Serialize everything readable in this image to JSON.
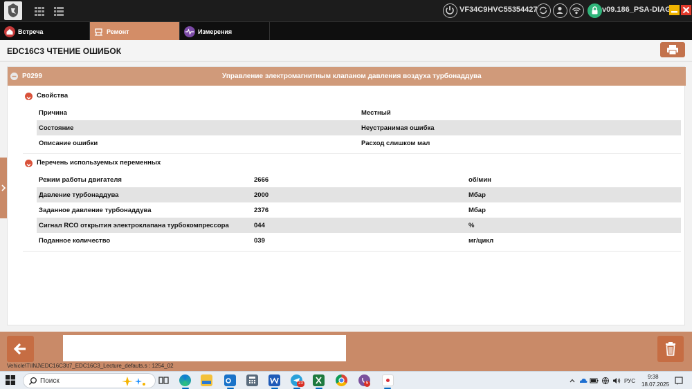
{
  "header": {
    "vin": "VF34C9HVC55354427",
    "version": "v09.186_PSA-DIAG"
  },
  "nav": {
    "tabs": [
      {
        "label": "Встреча"
      },
      {
        "label": "Ремонт"
      },
      {
        "label": "Измерения"
      }
    ]
  },
  "page": {
    "title": "EDC16C3 ЧТЕНИЕ ОШИБОК"
  },
  "fault": {
    "code": "P0299",
    "description": "Управление электромагнитным клапаном давления воздуха турбонаддува"
  },
  "properties": {
    "title": "Свойства",
    "rows": [
      {
        "name": "Причина",
        "value": "Местный"
      },
      {
        "name": "Состояние",
        "value": "Неустранимая ошибка"
      },
      {
        "name": "Описание ошибки",
        "value": "Расход слишком мал"
      }
    ]
  },
  "variables": {
    "title": "Перечень используемых переменных",
    "rows": [
      {
        "name": "Режим работы двигателя",
        "value": "2666",
        "unit": "об/мин"
      },
      {
        "name": "Давление турбонаддува",
        "value": "2000",
        "unit": "Мбар"
      },
      {
        "name": "Заданное давление турбонаддува",
        "value": "2376",
        "unit": "Мбар"
      },
      {
        "name": "Сигнал RCO открытия электроклапана турбокомпрессора",
        "value": "044",
        "unit": "%"
      },
      {
        "name": "Поданное количество",
        "value": "039",
        "unit": "мг/цикл"
      }
    ]
  },
  "footer": {
    "message": "",
    "path": "Vehicle\\T\\INJ\\EDC16C3\\t7_EDC16C3_Lecture_defauts.s : 1254_02"
  },
  "taskbar": {
    "search_placeholder": "Поиск",
    "language": "РУС",
    "time": "9:38",
    "date": "18.07.2025",
    "telegram_badge": "23",
    "viber_badge": "5"
  },
  "colors": {
    "accent": "#d38d67",
    "fault_header": "#d09a7a",
    "button": "#c66d43",
    "topbar": "#1c1c1c",
    "collapse": "#d9523a"
  }
}
